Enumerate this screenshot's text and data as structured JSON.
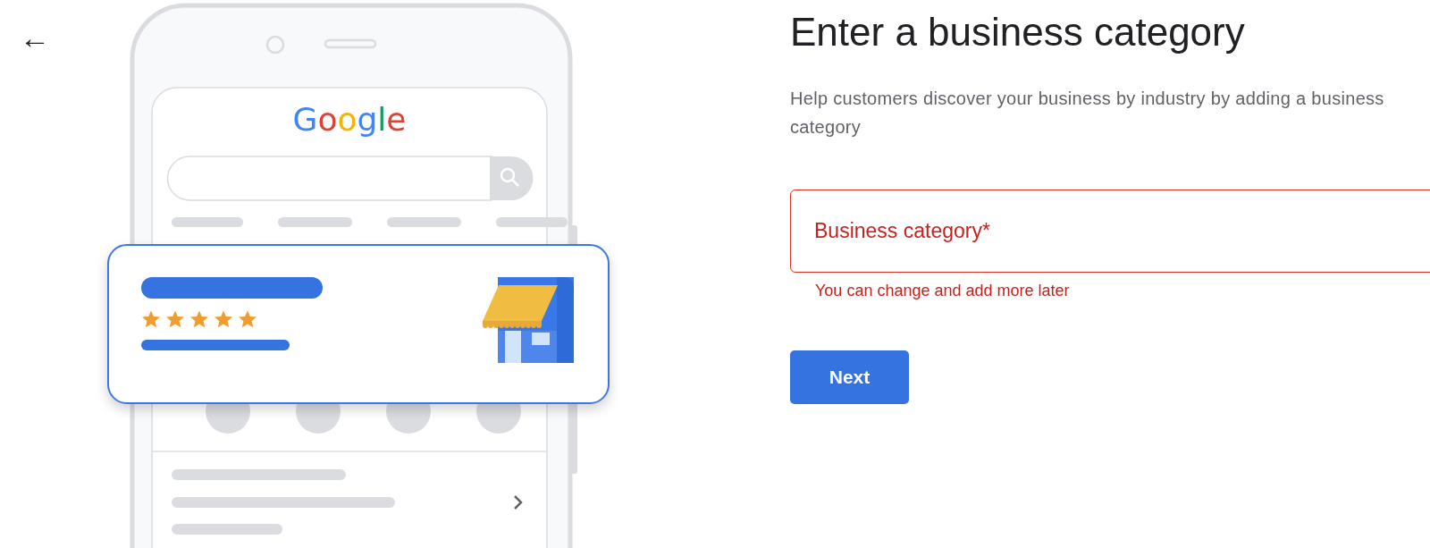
{
  "back_button": {
    "label": "←"
  },
  "illustration": {
    "logo": "Google",
    "listing_card": {
      "stars": 5
    }
  },
  "title": "Enter a business category",
  "description": "Help customers discover your business by industry by adding a business category",
  "category_field": {
    "placeholder": "Business category*",
    "error": true,
    "helper": "You can change and add more later"
  },
  "buttons": [
    {
      "label": "Next",
      "kind": "primary"
    }
  ]
}
